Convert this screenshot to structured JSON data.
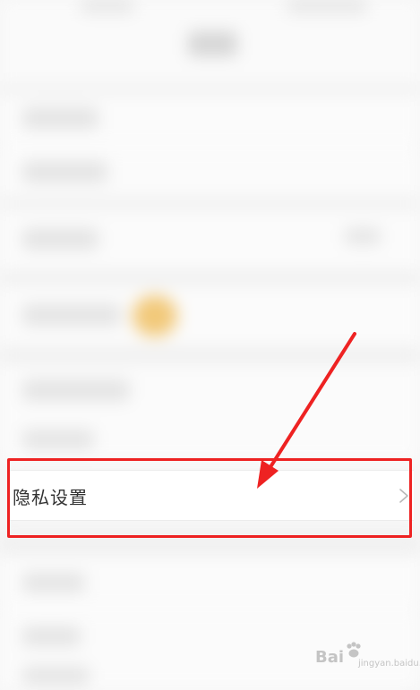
{
  "privacy_settings": {
    "label": "隐私设置",
    "chevron_icon": "chevron-right-icon"
  },
  "annotation": {
    "highlight_color": "#ee2222",
    "arrow_color": "#ee2222"
  },
  "watermark": {
    "brand": "Bai",
    "sub": "jingyan.baidu.com"
  }
}
